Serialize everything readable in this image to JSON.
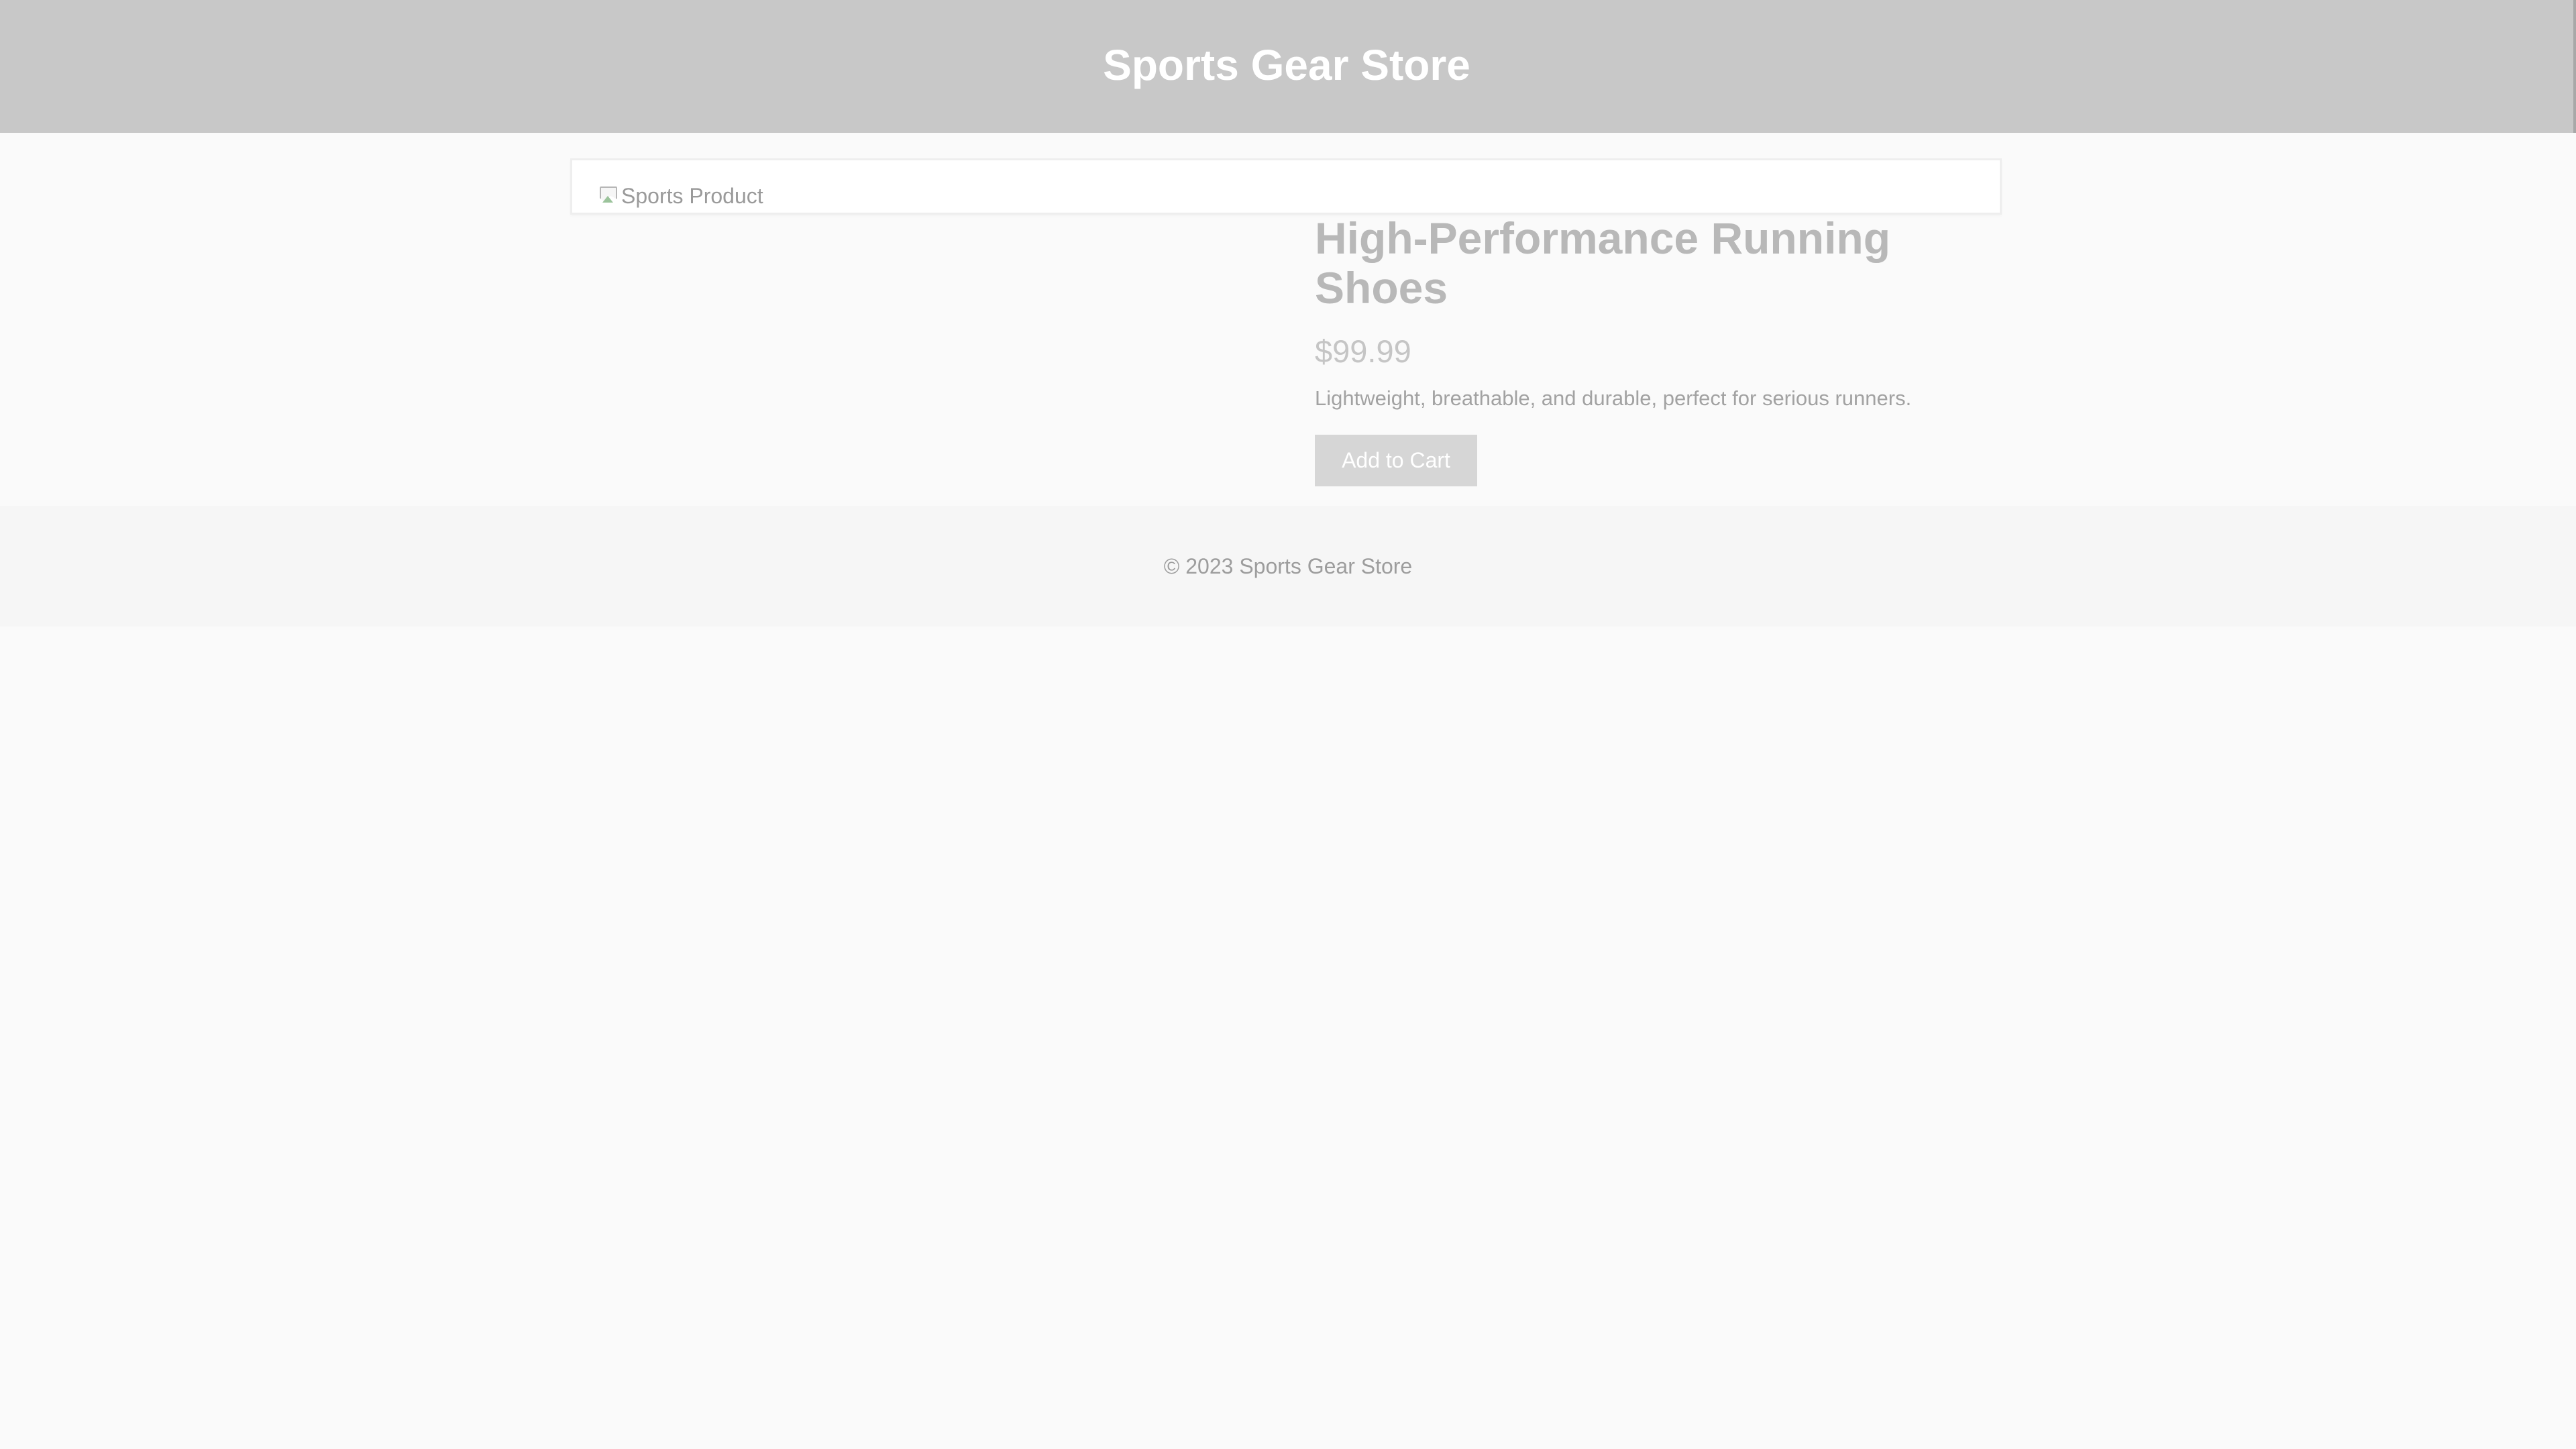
{
  "header": {
    "title": "Sports Gear Store"
  },
  "product": {
    "image_alt": "Sports Product",
    "name": "High-Performance Running Shoes",
    "price": "$99.99",
    "description": "Lightweight, breathable, and durable, perfect for serious runners.",
    "add_to_cart_label": "Add to Cart"
  },
  "footer": {
    "copyright": "© 2023 Sports Gear Store"
  },
  "colors": {
    "header_background": "#c8c8c8",
    "page_background": "#fafafa",
    "button_background": "#d6d6d6"
  },
  "icons": {
    "product_image": "broken-image-icon"
  }
}
